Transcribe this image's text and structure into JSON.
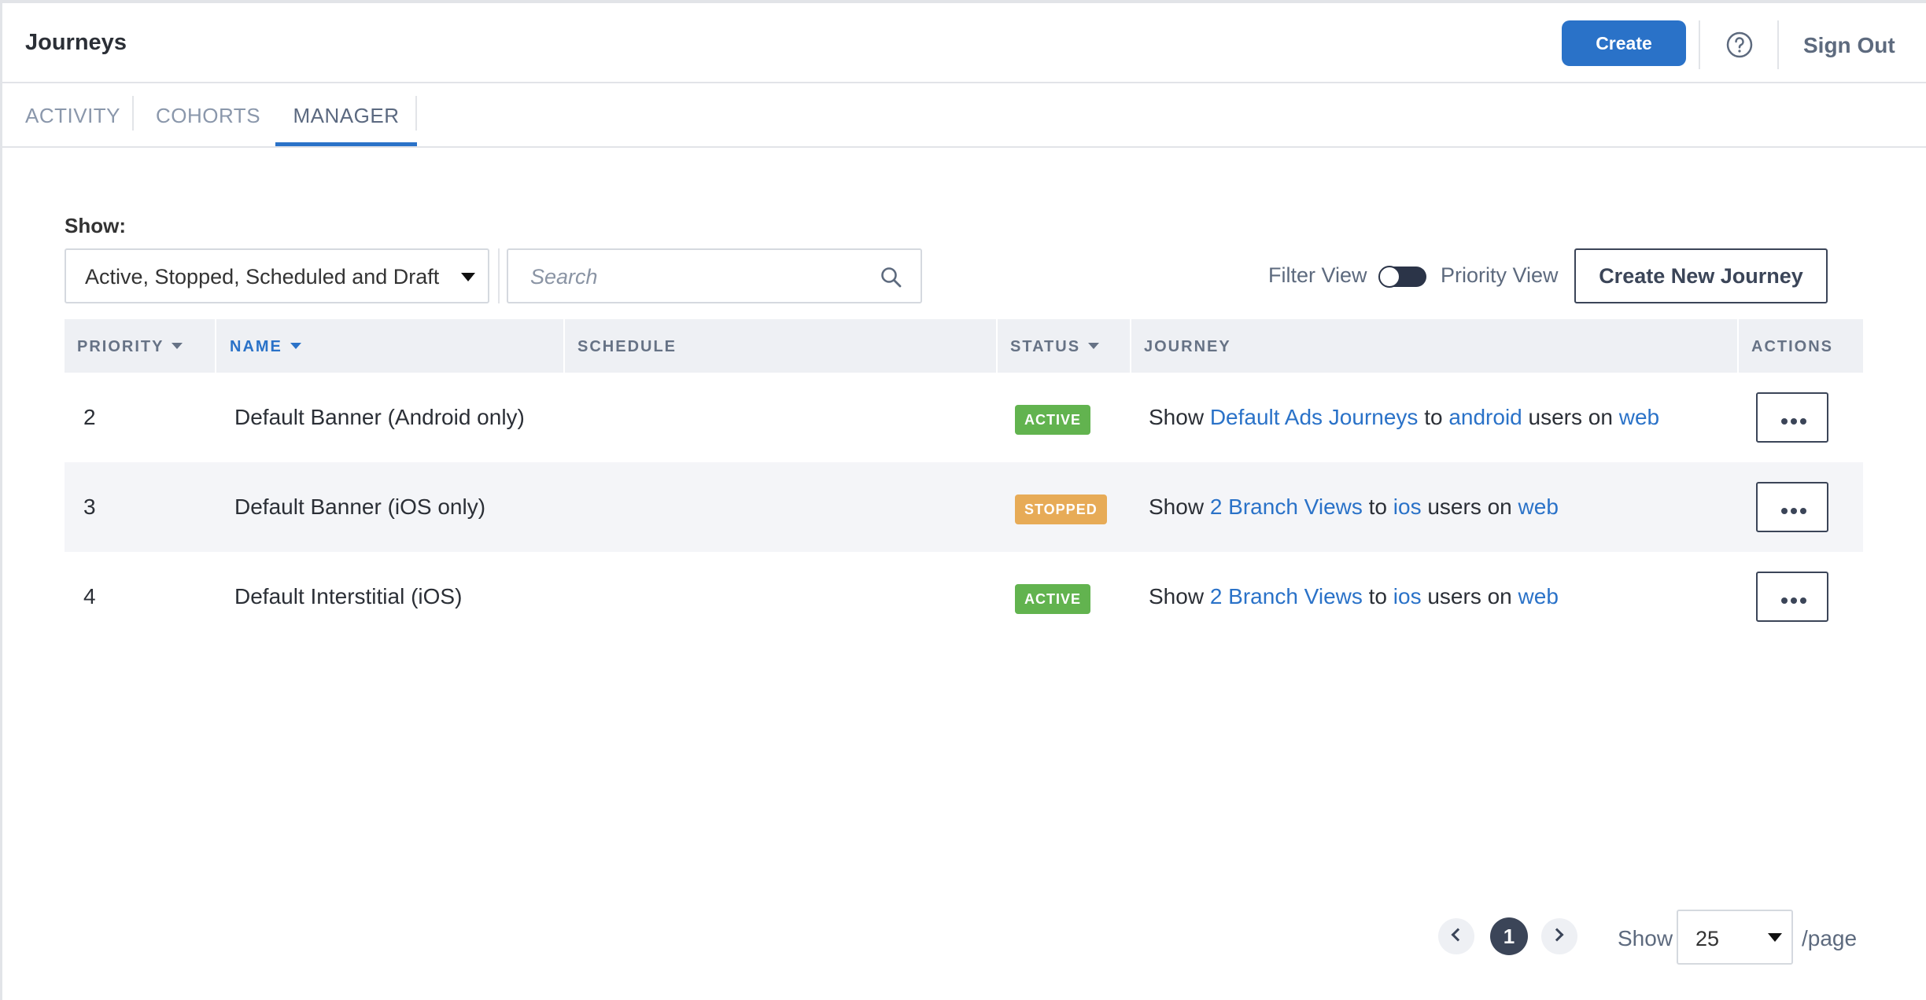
{
  "header": {
    "title": "Journeys",
    "create_label": "Create",
    "signout_label": "Sign Out"
  },
  "tabs": [
    {
      "label": "ACTIVITY",
      "active": false
    },
    {
      "label": "COHORTS",
      "active": false
    },
    {
      "label": "MANAGER",
      "active": true
    }
  ],
  "controls": {
    "show_label": "Show:",
    "status_filter": "Active, Stopped, Scheduled and Draft",
    "search_placeholder": "Search",
    "filter_view_label": "Filter View",
    "priority_view_label": "Priority View",
    "create_journey_label": "Create New Journey"
  },
  "table": {
    "columns": [
      "PRIORITY",
      "NAME",
      "SCHEDULE",
      "STATUS",
      "JOURNEY",
      "ACTIONS"
    ],
    "rows": [
      {
        "priority": "2",
        "name": "Default Banner (Android only)",
        "schedule": "",
        "status": "ACTIVE",
        "journey": {
          "show": "Show",
          "target": "Default Ads Journeys",
          "to": "to",
          "audience": "android",
          "users_on": "users on",
          "platform": "web"
        }
      },
      {
        "priority": "3",
        "name": "Default Banner (iOS only)",
        "schedule": "",
        "status": "STOPPED",
        "journey": {
          "show": "Show",
          "target": "2 Branch Views",
          "to": "to",
          "audience": "ios",
          "users_on": "users on",
          "platform": "web"
        }
      },
      {
        "priority": "4",
        "name": "Default Interstitial (iOS)",
        "schedule": "",
        "status": "ACTIVE",
        "journey": {
          "show": "Show",
          "target": "2 Branch Views",
          "to": "to",
          "audience": "ios",
          "users_on": "users on",
          "platform": "web"
        }
      }
    ]
  },
  "pagination": {
    "current_page": "1",
    "show_label": "Show",
    "per_page": "25",
    "per_page_suffix": "/page"
  },
  "colors": {
    "accent": "#2a72c8",
    "active_badge": "#62b34f",
    "stopped_badge": "#e7ab57",
    "dark": "#3b4558"
  },
  "icons": {
    "help": "help-circle-icon",
    "search": "search-icon",
    "dropdown": "caret-down-icon",
    "more": "more-horizontal-icon",
    "prev": "chevron-left-icon",
    "next": "chevron-right-icon"
  }
}
